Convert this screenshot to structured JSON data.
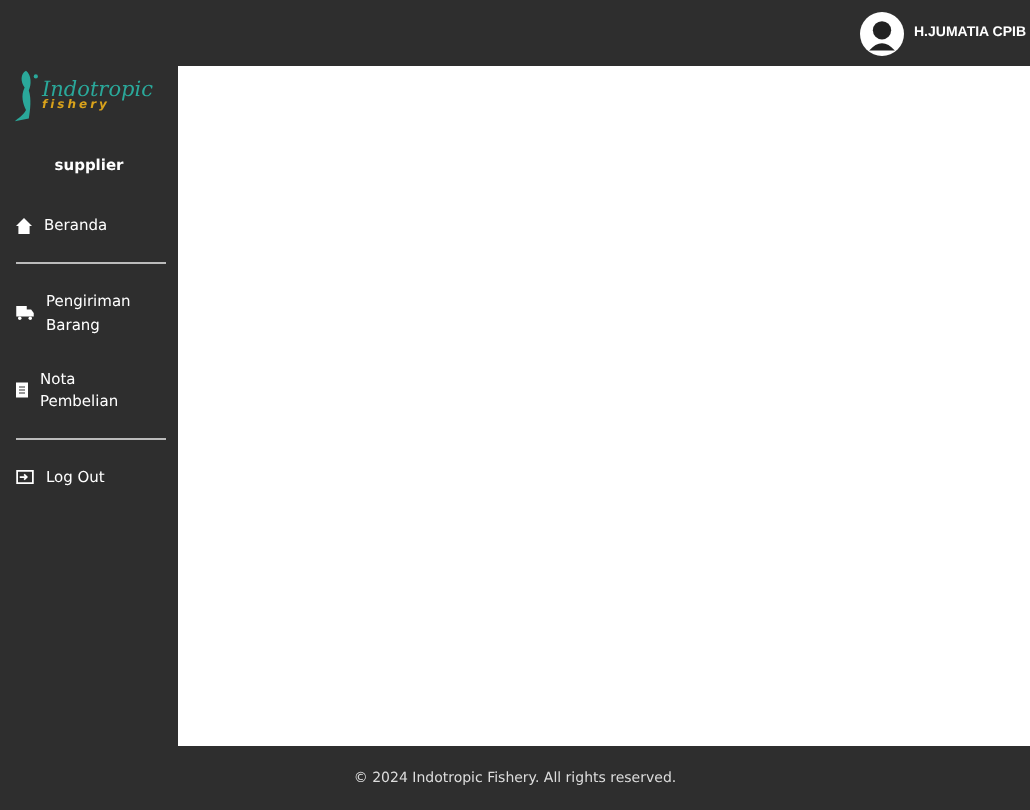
{
  "header": {
    "user_name": "H.JUMATIA CPIB"
  },
  "sidebar": {
    "logo": {
      "name": "Indotropic",
      "tagline": "fishery"
    },
    "role": "supplier",
    "menu_groups": [
      {
        "items": [
          {
            "label": "Beranda",
            "kind": "home"
          }
        ]
      },
      {
        "items": [
          {
            "label": "Pengiriman Barang",
            "kind": "truck"
          },
          {
            "label": "Nota Pembelian",
            "kind": "receipt"
          }
        ]
      },
      {
        "items": [
          {
            "label": "Log Out",
            "kind": "logout"
          }
        ]
      }
    ]
  },
  "footer": {
    "text": "© 2024 Indotropic Fishery. All rights reserved."
  }
}
